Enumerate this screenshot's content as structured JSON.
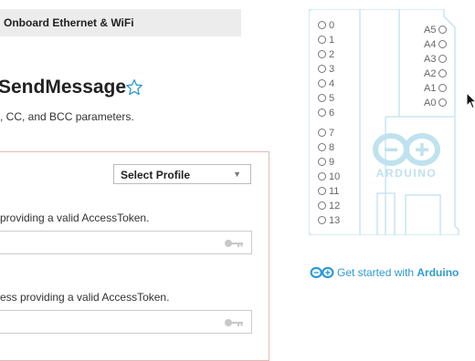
{
  "tab": {
    "label": "Onboard Ethernet & WiFi"
  },
  "choreo": {
    "title": "SendMessage",
    "description": ", CC, and BCC parameters."
  },
  "profile_select": {
    "selected": "Select Profile"
  },
  "fields": [
    {
      "help": "providing a valid AccessToken.",
      "value": ""
    },
    {
      "help": "ess providing a valid AccessToken.",
      "value": ""
    }
  ],
  "board": {
    "digital_pins": [
      "0",
      "1",
      "2",
      "3",
      "4",
      "5",
      "6",
      "7",
      "8",
      "9",
      "10",
      "11",
      "12",
      "13"
    ],
    "analog_pins": [
      "A5",
      "A4",
      "A3",
      "A2",
      "A1",
      "A0"
    ],
    "logo_text": "ARDUINO"
  },
  "get_started": {
    "text": "Get started with",
    "brand": "Arduino"
  },
  "colors": {
    "accent": "#2f9bd3",
    "board_outline": "#bfe2ee",
    "panel_border": "#e3b8b8"
  }
}
